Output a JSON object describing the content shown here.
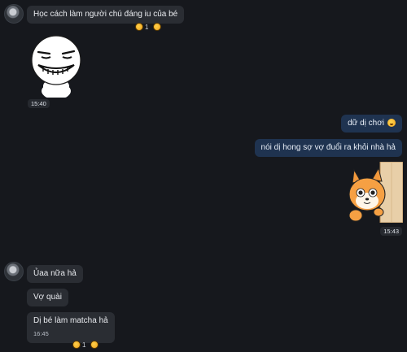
{
  "messages": {
    "m1": {
      "text": "Học cách làm người chú đáng iu của bé",
      "reaction_count": "1"
    },
    "sticker1": {
      "time": "15:40"
    },
    "m2": {
      "text": "dữ dị chơi"
    },
    "m3": {
      "text": "nói dị hong sợ vợ đuổi ra khỏi nhà hả"
    },
    "sticker2": {
      "time": "15:43"
    },
    "m4": {
      "text": "Ủaa nữa hả"
    },
    "m5": {
      "text": "Vợ quài"
    },
    "m6": {
      "text": "Dị bé làm matcha hả",
      "time": "16:45",
      "reaction_count": "1"
    }
  },
  "colors": {
    "background": "#16181d",
    "incoming_bubble": "#2a2d33",
    "outgoing_bubble": "#1f3350"
  },
  "icons": {
    "reaction": "laughing-face-icon",
    "inline_emoji": "winking-face-icon"
  }
}
